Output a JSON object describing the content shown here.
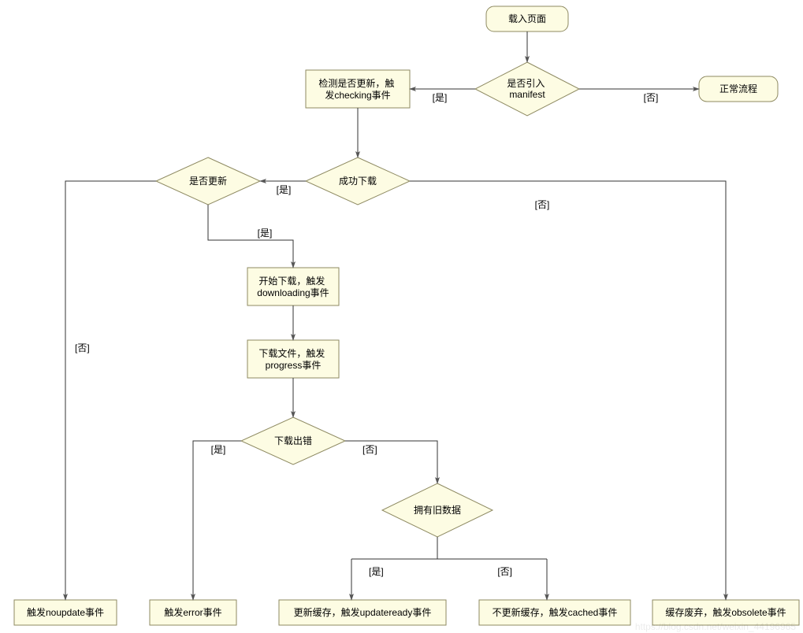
{
  "colors": {
    "node_fill": "#FDFCE3",
    "node_stroke": "#8E8A62"
  },
  "nodes": {
    "load_page": {
      "text": "载入页面"
    },
    "import_manifest": {
      "text": "是否引入\nmanifest"
    },
    "normal_flow": {
      "text": "正常流程"
    },
    "checking": {
      "text": "检测是否更新，触\n发checking事件"
    },
    "download_ok": {
      "text": "成功下载"
    },
    "is_update": {
      "text": "是否更新"
    },
    "downloading": {
      "text": "开始下载，触发\ndownloading事件"
    },
    "progress": {
      "text": "下载文件，触发\nprogress事件"
    },
    "download_error": {
      "text": "下载出错"
    },
    "has_old_data": {
      "text": "拥有旧数据"
    },
    "noupdate": {
      "text": "触发noupdate事件"
    },
    "error": {
      "text": "触发error事件"
    },
    "updateready": {
      "text": "更新缓存，触发updateready事件"
    },
    "cached": {
      "text": "不更新缓存，触发cached事件"
    },
    "obsolete": {
      "text": "缓存废弃，触发obsolete事件"
    }
  },
  "edge_labels": {
    "yes": "[是]",
    "no": "[否]"
  },
  "watermark": "https://blog.csdn.net/weixin_44196965"
}
